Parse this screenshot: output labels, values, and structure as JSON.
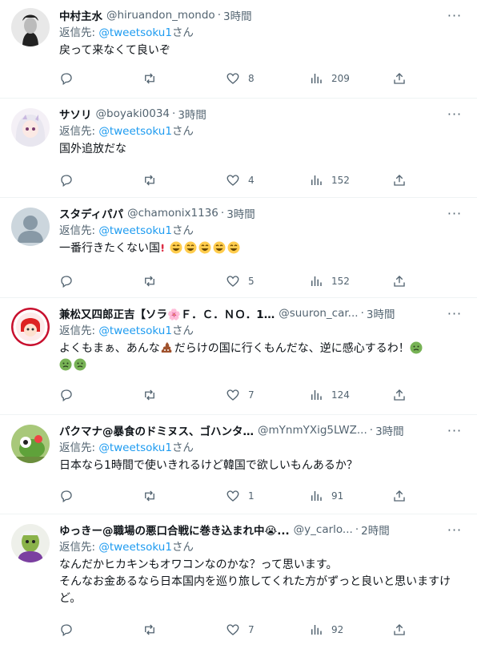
{
  "reply_prefix": "返信先: ",
  "reply_suffix": "さん",
  "more_label": "···",
  "colors": {
    "text": "#0f1419",
    "secondary": "#536471",
    "link": "#1d9bf0",
    "border": "#eff3f4"
  },
  "tweets": [
    {
      "name": "中村主水",
      "handle": "@hiruandon_mondo",
      "time": "3時間",
      "mention": "@tweetsoku1",
      "text": "戻って来なくて良いぞ",
      "likes": "8",
      "views": "209",
      "retweets": ""
    },
    {
      "name": "サソリ",
      "handle": "@boyaki0034",
      "time": "3時間",
      "mention": "@tweetsoku1",
      "text": "国外追放だな",
      "likes": "4",
      "views": "152",
      "retweets": ""
    },
    {
      "name": "スタディパパ",
      "handle": "@chamonix1136",
      "time": "3時間",
      "mention": "@tweetsoku1",
      "text": "一番行きたくない国",
      "likes": "5",
      "views": "152",
      "retweets": ""
    },
    {
      "name": "兼松又四郎正吉【ソラ🌸Ｆ．Ｃ．ＮＯ．1…",
      "handle": "@suuron_car...",
      "time": "3時間",
      "mention": "@tweetsoku1",
      "text_a": "よくもまぁ、あんな",
      "text_b": "だらけの国に行くもんだな、逆に感心するわ！",
      "likes": "7",
      "views": "124",
      "retweets": ""
    },
    {
      "name": "パクマナ@暴食のドミヌス、ゴハンタ…",
      "handle": "@mYnmYXig5LWZ...",
      "time": "3時間",
      "mention": "@tweetsoku1",
      "text": "日本なら1時間で使いきれるけど韓国で欲しいもんあるか？",
      "likes": "1",
      "views": "91",
      "retweets": ""
    },
    {
      "name": "ゆっきー@職場の悪口合戦に巻き込まれ中😭...",
      "handle": "@y_carlo...",
      "time": "2時間",
      "mention": "@tweetsoku1",
      "text": "なんだかヒカキンもオワコンなのかな？って思います。\nそんなお金あるなら日本国内を巡り旅してくれた方がずっと良いと思いますけど。",
      "likes": "7",
      "views": "92",
      "retweets": ""
    }
  ]
}
